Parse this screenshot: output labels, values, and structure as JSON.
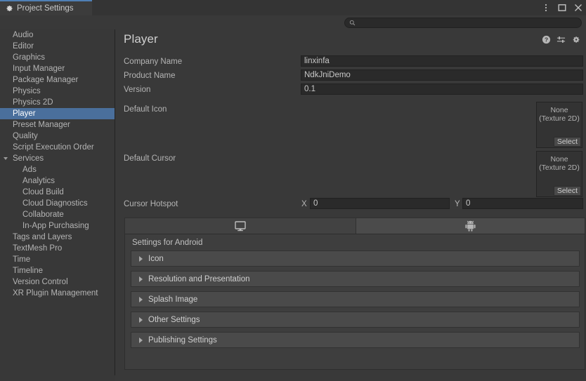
{
  "window": {
    "tab_title": "Project Settings",
    "tab_icon": "gear-icon",
    "controls": [
      {
        "name": "more-options-icon",
        "glyph": "kebab"
      },
      {
        "name": "maximize-icon",
        "glyph": "square"
      },
      {
        "name": "close-icon",
        "glyph": "x"
      }
    ]
  },
  "search": {
    "placeholder": "",
    "value": "",
    "icon": "search-icon"
  },
  "sidebar": {
    "items": [
      {
        "label": "Audio",
        "level": 0,
        "selected": false,
        "arrow": ""
      },
      {
        "label": "Editor",
        "level": 0,
        "selected": false,
        "arrow": ""
      },
      {
        "label": "Graphics",
        "level": 0,
        "selected": false,
        "arrow": ""
      },
      {
        "label": "Input Manager",
        "level": 0,
        "selected": false,
        "arrow": ""
      },
      {
        "label": "Package Manager",
        "level": 0,
        "selected": false,
        "arrow": ""
      },
      {
        "label": "Physics",
        "level": 0,
        "selected": false,
        "arrow": ""
      },
      {
        "label": "Physics 2D",
        "level": 0,
        "selected": false,
        "arrow": ""
      },
      {
        "label": "Player",
        "level": 0,
        "selected": true,
        "arrow": ""
      },
      {
        "label": "Preset Manager",
        "level": 0,
        "selected": false,
        "arrow": ""
      },
      {
        "label": "Quality",
        "level": 0,
        "selected": false,
        "arrow": ""
      },
      {
        "label": "Script Execution Order",
        "level": 0,
        "selected": false,
        "arrow": ""
      },
      {
        "label": "Services",
        "level": 0,
        "selected": false,
        "arrow": "open"
      },
      {
        "label": "Ads",
        "level": 1,
        "selected": false,
        "arrow": ""
      },
      {
        "label": "Analytics",
        "level": 1,
        "selected": false,
        "arrow": ""
      },
      {
        "label": "Cloud Build",
        "level": 1,
        "selected": false,
        "arrow": ""
      },
      {
        "label": "Cloud Diagnostics",
        "level": 1,
        "selected": false,
        "arrow": ""
      },
      {
        "label": "Collaborate",
        "level": 1,
        "selected": false,
        "arrow": ""
      },
      {
        "label": "In-App Purchasing",
        "level": 1,
        "selected": false,
        "arrow": ""
      },
      {
        "label": "Tags and Layers",
        "level": 0,
        "selected": false,
        "arrow": ""
      },
      {
        "label": "TextMesh Pro",
        "level": 0,
        "selected": false,
        "arrow": ""
      },
      {
        "label": "Time",
        "level": 0,
        "selected": false,
        "arrow": ""
      },
      {
        "label": "Timeline",
        "level": 0,
        "selected": false,
        "arrow": ""
      },
      {
        "label": "Version Control",
        "level": 0,
        "selected": false,
        "arrow": ""
      },
      {
        "label": "XR Plugin Management",
        "level": 0,
        "selected": false,
        "arrow": ""
      }
    ]
  },
  "page": {
    "title": "Player",
    "header_icons": [
      {
        "name": "help-icon"
      },
      {
        "name": "preset-icon"
      },
      {
        "name": "settings-gear-icon"
      }
    ],
    "fields": {
      "company_name_label": "Company Name",
      "company_name_value": "linxinfa",
      "product_name_label": "Product Name",
      "product_name_value": "NdkJniDemo",
      "version_label": "Version",
      "version_value": "0.1",
      "default_icon_label": "Default Icon",
      "default_cursor_label": "Default Cursor",
      "cursor_hotspot_label": "Cursor Hotspot",
      "hotspot_x_letter": "X",
      "hotspot_x_value": "0",
      "hotspot_y_letter": "Y",
      "hotspot_y_value": "0"
    },
    "object_fields": [
      {
        "name": "default-icon",
        "line1": "None",
        "line2": "(Texture 2D)",
        "select_label": "Select"
      },
      {
        "name": "default-cursor",
        "line1": "None",
        "line2": "(Texture 2D)",
        "select_label": "Select"
      }
    ],
    "platform_tabs": [
      {
        "name": "tab-standalone",
        "icon": "monitor-icon",
        "selected": false
      },
      {
        "name": "tab-android",
        "icon": "android-icon",
        "selected": true
      }
    ],
    "settings_header": "Settings for Android",
    "foldouts": [
      {
        "label": "Icon",
        "expanded": false
      },
      {
        "label": "Resolution and Presentation",
        "expanded": false
      },
      {
        "label": "Splash Image",
        "expanded": false
      },
      {
        "label": "Other Settings",
        "expanded": false
      },
      {
        "label": "Publishing Settings",
        "expanded": false
      }
    ]
  },
  "colors": {
    "accent_tab": "#4f7fb5",
    "selection": "#4a6f9c",
    "background": "#383838",
    "panel": "#393939",
    "field": "#2a2a2a"
  }
}
